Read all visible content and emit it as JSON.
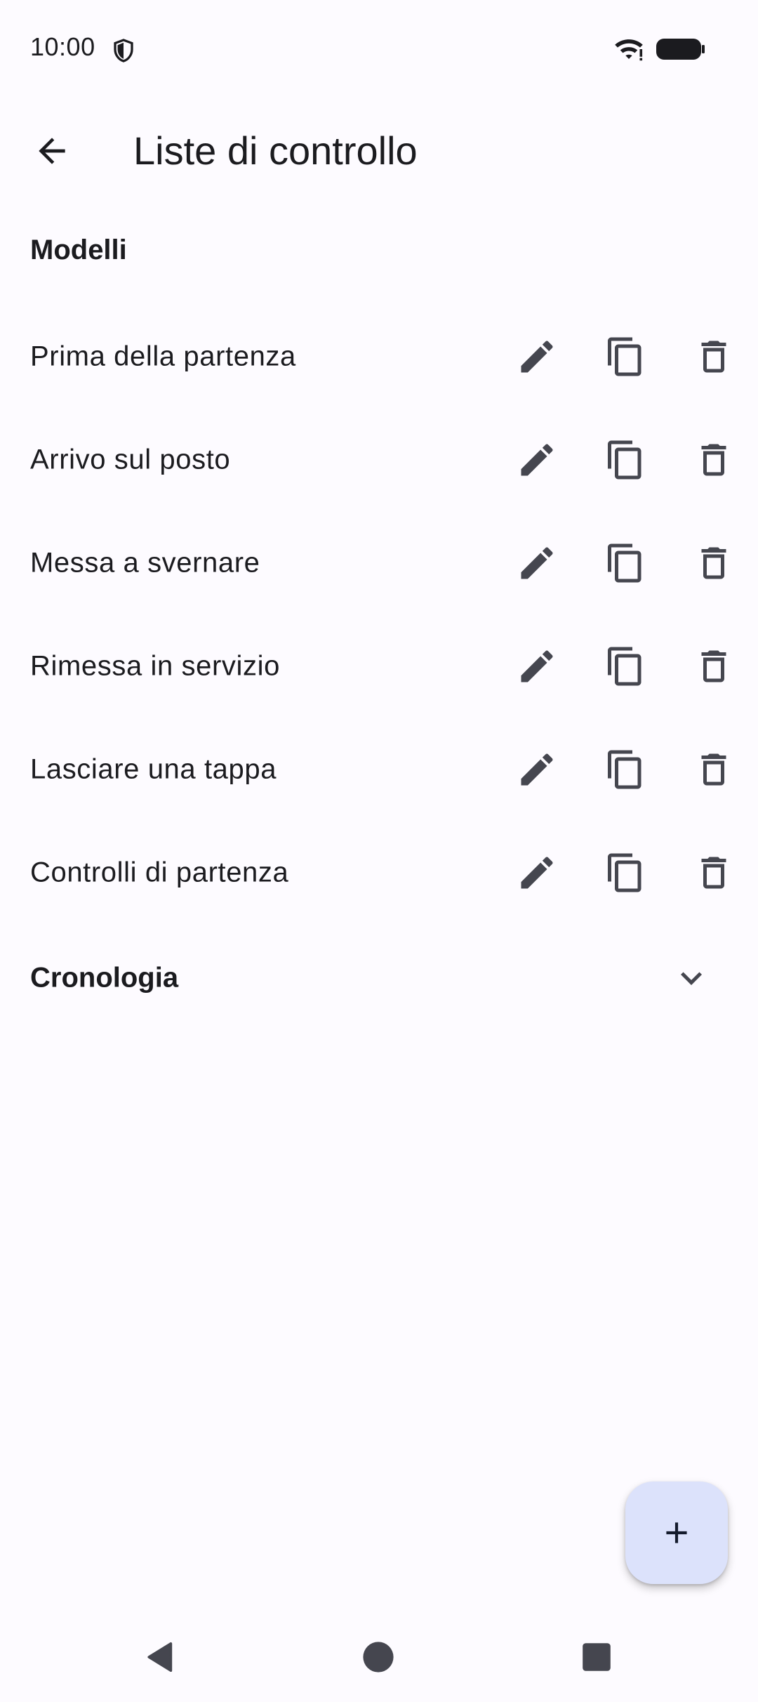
{
  "status_bar": {
    "time": "10:00",
    "icons": [
      "shield-icon",
      "wifi-icon",
      "battery-icon"
    ]
  },
  "app_bar": {
    "title": "Liste di controllo",
    "back_icon": "arrow-back-icon"
  },
  "templates_section": {
    "header": "Modelli",
    "items": [
      {
        "label": "Prima della partenza"
      },
      {
        "label": "Arrivo sul posto"
      },
      {
        "label": "Messa a svernare"
      },
      {
        "label": "Rimessa in servizio"
      },
      {
        "label": "Lasciare una tappa"
      },
      {
        "label": "Controlli di partenza"
      }
    ],
    "row_actions": [
      "edit-icon",
      "copy-icon",
      "delete-icon"
    ]
  },
  "history_section": {
    "header": "Cronologia",
    "expanded": false
  },
  "fab": {
    "icon": "plus-icon"
  },
  "colors": {
    "background": "#fdfbff",
    "icon": "#45464f",
    "text": "#1b1b1f",
    "fab_container": "#dce2fb",
    "fab_icon": "#141b2c"
  }
}
